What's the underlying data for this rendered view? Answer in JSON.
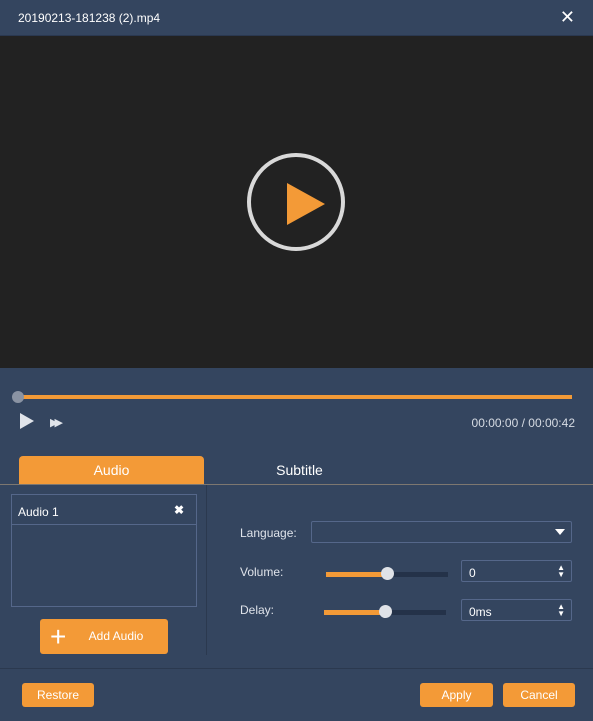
{
  "window": {
    "title": "20190213-181238 (2).mp4",
    "close_icon": "close-icon"
  },
  "player": {
    "progress": 0,
    "current_time": "00:00:00",
    "total_time": "00:00:42",
    "separator": "/"
  },
  "tabs": [
    {
      "label": "Audio",
      "active": true
    },
    {
      "label": "Subtitle",
      "active": false
    }
  ],
  "audio_list": {
    "items": [
      {
        "label": "Audio 1"
      }
    ],
    "remove_glyph": "✖",
    "add_label": "Add Audio"
  },
  "settings": {
    "language": {
      "label": "Language:",
      "value": ""
    },
    "volume": {
      "label": "Volume:",
      "value": "0",
      "slider_percent": 50
    },
    "delay": {
      "label": "Delay:",
      "value": "0ms",
      "slider_percent": 50
    }
  },
  "buttons": {
    "restore": "Restore",
    "apply": "Apply",
    "cancel": "Cancel"
  },
  "colors": {
    "accent": "#f39a37",
    "background": "#34455f",
    "video": "#222222"
  }
}
